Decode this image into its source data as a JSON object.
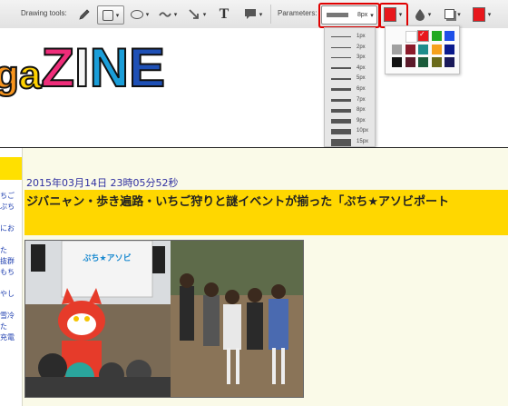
{
  "toolbar": {
    "drawing_tools_label": "Drawing tools:",
    "parameters_label": "Parameters:",
    "tools": [
      {
        "name": "pencil",
        "icon": "pencil-icon"
      },
      {
        "name": "rectangle",
        "icon": "rectangle-icon",
        "selected": true
      },
      {
        "name": "ellipse",
        "icon": "ellipse-icon"
      },
      {
        "name": "curve",
        "icon": "curve-icon"
      },
      {
        "name": "arrow",
        "icon": "arrow-icon"
      },
      {
        "name": "text",
        "icon": "text-icon",
        "glyph": "T"
      },
      {
        "name": "comment",
        "icon": "speech-bubble-icon"
      }
    ],
    "line_width_value": "8px",
    "stroke_color": "#e8171c",
    "secondary_color": "#e8171c"
  },
  "width_menu": {
    "options": [
      "1px",
      "2px",
      "3px",
      "4px",
      "5px",
      "6px",
      "7px",
      "8px",
      "9px",
      "10px",
      "15px"
    ]
  },
  "color_palette": {
    "selected": "#e8171c",
    "colors": [
      [
        "#ffffff",
        "#e8171c",
        "#22aa22",
        "#1d4fe8"
      ],
      [
        "#a0a0a0",
        "#8b1a2a",
        "#1d8c8c",
        "#f5a11d",
        "#0a1a8c"
      ],
      [
        "#111111",
        "#5a1a2a",
        "#1a5a3a",
        "#6a6a1a",
        "#1a1a5a"
      ]
    ]
  },
  "banner": {
    "logo_parts": [
      "g",
      "a",
      "Z",
      "I",
      "N",
      "E"
    ]
  },
  "article": {
    "date": "2015年03月14日 23時05分52秒",
    "title": "ジバニャン・歩き遍路・いちご狩りと謎イベントが揃った「ぷち★アソビポート"
  },
  "sidebar": {
    "snippets": "ちご\nぷち\n\nにお\n\nた\n抜群\nもち\n\nやし\n\n雪冷\nた\n充電"
  },
  "photo": {
    "booth_sign": "ぷち★アソビ"
  }
}
